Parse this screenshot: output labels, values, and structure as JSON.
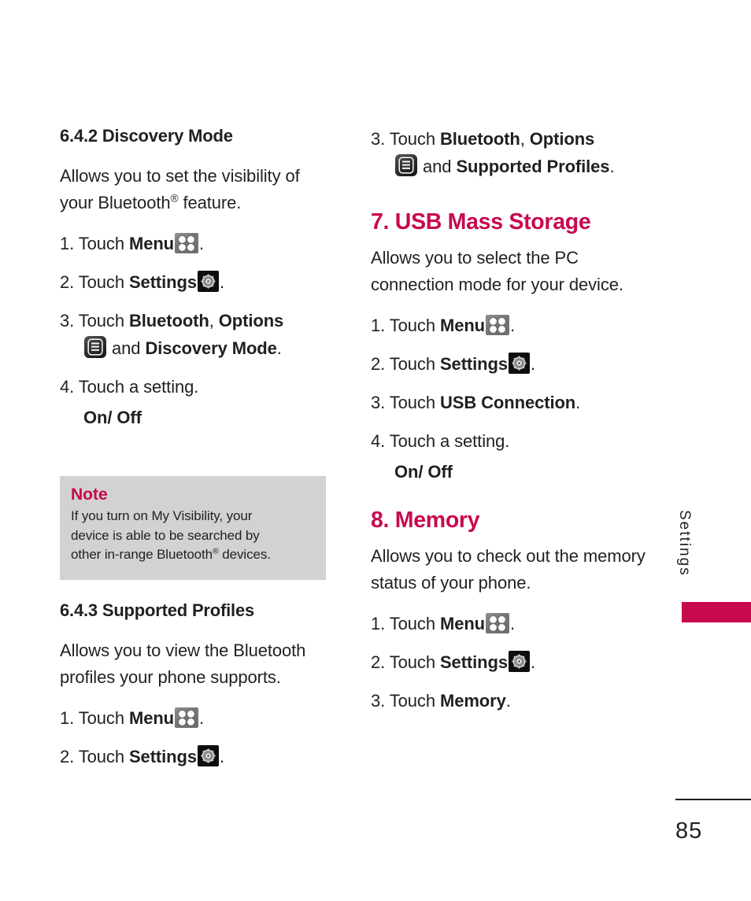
{
  "page": {
    "number": "85",
    "side_tab_label": "Settings"
  },
  "colors": {
    "accent": "#c8084f",
    "text": "#231f20",
    "note_bg": "#d2d2d2"
  },
  "icons": {
    "menu": "menu-grid-icon",
    "settings": "gear-icon",
    "options": "options-list-icon"
  },
  "left_column": {
    "section_1": {
      "heading": "6.4.2 Discovery Mode",
      "description_1": "Allows you to set the visibility of",
      "description_2": "your Bluetooth",
      "description_reg": "®",
      "description_3": " feature.",
      "steps": [
        {
          "num": "1. Touch ",
          "bold": "Menu",
          "icon": "menu",
          "tail": "."
        },
        {
          "num": "2. Touch ",
          "bold": "Settings",
          "icon": "settings",
          "tail": "."
        },
        {
          "num": "3. Touch ",
          "bold": "Bluetooth",
          "mid": ", ",
          "bold2": "Options",
          "icon": "options",
          "tail2": " and ",
          "bold3": "Discovery Mode",
          "tail": "."
        },
        {
          "num": "4. Touch a setting.",
          "bold": "",
          "icon": null,
          "tail": ""
        }
      ],
      "option_values": "On/ Off"
    },
    "note": {
      "title": "Note",
      "line_1": "If you turn on My Visibility, your",
      "line_2": "device is able to be searched by",
      "line_3a": "other in-range Bluetooth",
      "line_3_reg": "®",
      "line_3b": " devices."
    },
    "section_2": {
      "heading": "6.4.3 Supported Profiles",
      "description_1": "Allows you to view the Bluetooth",
      "description_2": "profiles your phone supports.",
      "steps": [
        {
          "num": "1. Touch ",
          "bold": "Menu",
          "icon": "menu",
          "tail": "."
        },
        {
          "num": "2. Touch ",
          "bold": "Settings",
          "icon": "settings",
          "tail": "."
        }
      ]
    }
  },
  "right_column": {
    "continued_step": {
      "num": "3. Touch ",
      "bold": "Bluetooth",
      "mid": ", ",
      "bold2": "Options",
      "icon": "options",
      "tail2": " and ",
      "bold3": "Supported Profiles",
      "tail": "."
    },
    "section_7": {
      "heading": "7. USB Mass Storage",
      "description_1": "Allows you to select the PC",
      "description_2": "connection mode for your",
      "description_3": "device.",
      "steps": [
        {
          "num": "1. Touch ",
          "bold": "Menu",
          "icon": "menu",
          "tail": "."
        },
        {
          "num": "2. Touch ",
          "bold": "Settings",
          "icon": "settings",
          "tail": "."
        },
        {
          "num": "3. Touch ",
          "bold": "USB Connection",
          "icon": null,
          "tail": "."
        },
        {
          "num": "4. Touch a setting.",
          "bold": "",
          "icon": null,
          "tail": ""
        }
      ],
      "option_values": "On/ Off"
    },
    "section_8": {
      "heading": "8. Memory",
      "description_1": "Allows you to check out the",
      "description_2": "memory status of your phone.",
      "steps": [
        {
          "num": "1. Touch ",
          "bold": "Menu",
          "icon": "menu",
          "tail": "."
        },
        {
          "num": "2. Touch ",
          "bold": "Settings",
          "icon": "settings",
          "tail": "."
        },
        {
          "num": "3. Touch ",
          "bold": "Memory",
          "icon": null,
          "tail": "."
        }
      ]
    }
  }
}
